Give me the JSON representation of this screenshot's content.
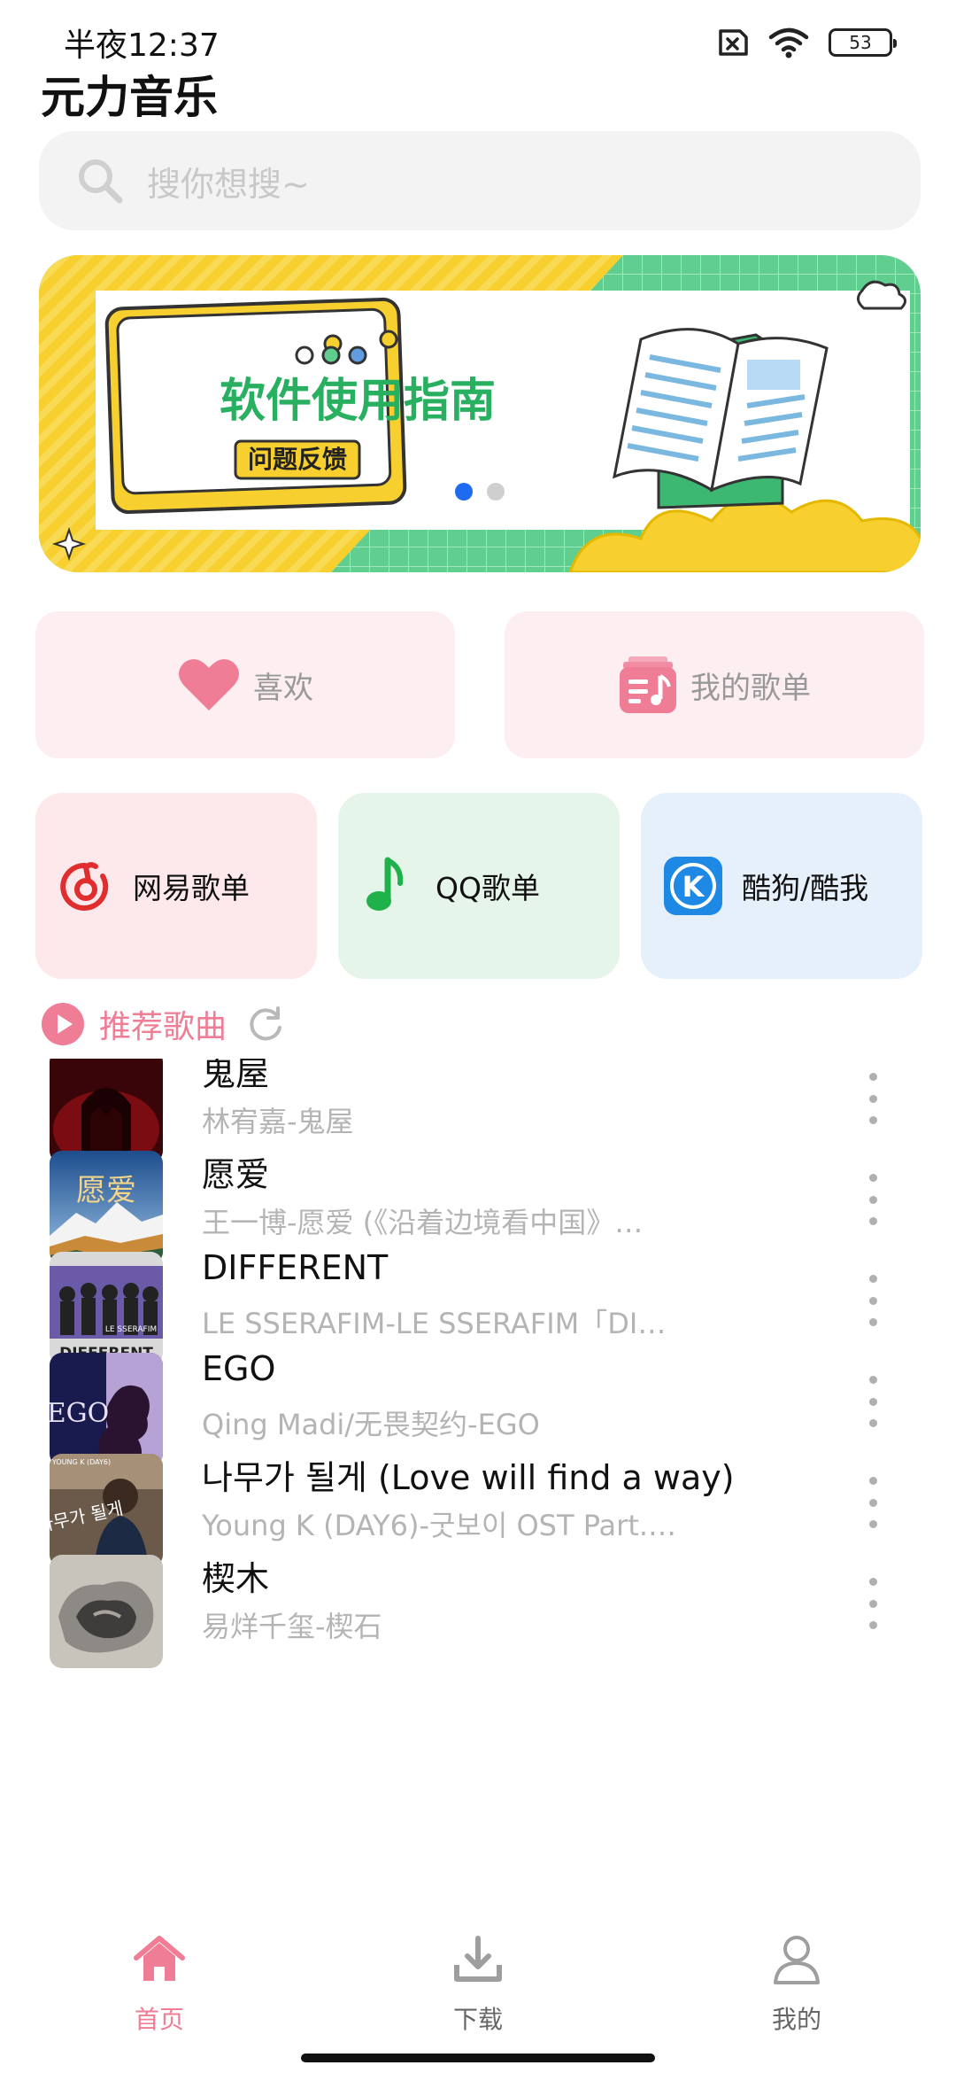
{
  "status_bar": {
    "time": "半夜12:37",
    "battery": "53"
  },
  "app": {
    "title": "元力音乐"
  },
  "search": {
    "placeholder": "搜你想搜~"
  },
  "banner": {
    "headline": "软件使用指南",
    "button": "问题反馈",
    "page_count": 2,
    "active_page": 1
  },
  "quick_cards": [
    {
      "label": "喜欢",
      "icon": "heart-icon"
    },
    {
      "label": "我的歌单",
      "icon": "playlist-icon"
    }
  ],
  "source_cards": [
    {
      "label": "网易歌单",
      "icon": "netease-icon",
      "bg": "#fde9ec"
    },
    {
      "label": "QQ歌单",
      "icon": "qq-music-icon",
      "bg": "#e6f5ea"
    },
    {
      "label": "酷狗/酷我",
      "icon": "kugou-icon",
      "bg": "#e6f0fb"
    }
  ],
  "section": {
    "title": "推荐歌曲",
    "refresh_icon": "refresh-icon"
  },
  "songs": [
    {
      "title": "鬼屋",
      "subtitle": "林宥嘉-鬼屋"
    },
    {
      "title": "愿爱",
      "subtitle": "王一博-愿爱 (《沿着边境看中国》…"
    },
    {
      "title": "DIFFERENT",
      "subtitle": "LE SSERAFIM-LE SSERAFIM「DI…"
    },
    {
      "title": "EGO",
      "subtitle": "Qing Madi/无畏契约-EGO"
    },
    {
      "title": "나무가 될게 (Love will find a way)",
      "subtitle": "Young K (DAY6)-굿보이 OST Part.…"
    },
    {
      "title": "楔木",
      "subtitle": "易烊千玺-楔石"
    }
  ],
  "covers": {
    "cover1_text": "愿爱",
    "cover2_text": "DIFFERENT",
    "cover2_tag": "LE SSERAFIM",
    "cover3_text": "EGO",
    "cover4_text": "나무가 될게",
    "cover4_tag": "YOUNG K (DAY6)"
  },
  "nav": [
    {
      "label": "首页",
      "icon": "home-icon",
      "active": true
    },
    {
      "label": "下载",
      "icon": "download-icon",
      "active": false
    },
    {
      "label": "我的",
      "icon": "profile-icon",
      "active": false
    }
  ],
  "colors": {
    "accent": "#ee7d95",
    "netease": "#e02e2e",
    "qq": "#20b24a",
    "kugou": "#1e88e5"
  }
}
